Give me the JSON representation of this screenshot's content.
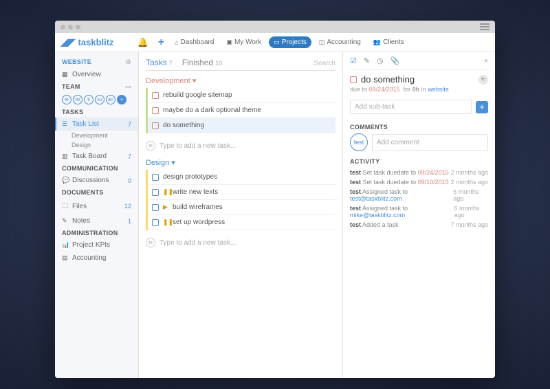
{
  "brand": "taskblitz",
  "topnav": {
    "dashboard": "Dashboard",
    "mywork": "My Work",
    "projects": "Projects",
    "accounting": "Accounting",
    "clients": "Clients"
  },
  "sidebar": {
    "website": "WEBSITE",
    "overview": "Overview",
    "team": "TEAM",
    "team_members": [
      "te",
      "mi",
      "ti",
      "su",
      "an"
    ],
    "tasks": "TASKS",
    "tasklist": "Task List",
    "tasklist_count": "7",
    "dev": "Development",
    "design": "Design",
    "taskboard": "Task Board",
    "taskboard_count": "7",
    "communication": "COMMUNICATION",
    "discussions": "Discussions",
    "discussions_count": "0",
    "documents": "DOCUMENTS",
    "files": "Files",
    "files_count": "12",
    "notes": "Notes",
    "notes_count": "1",
    "administration": "ADMINISTRATION",
    "kpis": "Project KPIs",
    "accounting": "Accounting"
  },
  "tabs": {
    "tasks": "Tasks",
    "tasks_count": "7",
    "finished": "Finished",
    "finished_count": "10",
    "search": "Search"
  },
  "groups": {
    "dev": "Development",
    "design": "Design"
  },
  "tasks_dev": [
    "rebuild google sitemap",
    "maybe do a dark optional theme",
    "do something"
  ],
  "tasks_design": [
    "design prototypes",
    "write new texts",
    "build wireframes",
    "set up wordpress"
  ],
  "new_task_placeholder": "Type to add a new task...",
  "detail": {
    "title": "do something",
    "due_label": "due to",
    "due_date": "09/24/2015",
    "for_label": "for",
    "hours": "0h",
    "in_label": "in",
    "project": "website",
    "subtask_placeholder": "Add sub-task",
    "comments": "COMMENTS",
    "comment_avatar": "test",
    "comment_placeholder": "Add comment",
    "activity": "ACTIVITY",
    "badge": "te"
  },
  "activity": [
    {
      "user": "test",
      "action": "Set task duedate to",
      "date": "09/24/2015",
      "time": "2 months ago"
    },
    {
      "user": "test",
      "action": "Set task duedate to",
      "date": "09/10/2015",
      "time": "2 months ago"
    },
    {
      "user": "test",
      "action": "Assigned task to",
      "email": "test@taskblitz.com",
      "time": "6 months ago"
    },
    {
      "user": "test",
      "action": "Assigned task to",
      "email": "mike@taskblitz.com",
      "time": "6 months ago"
    },
    {
      "user": "test",
      "action": "Added a task",
      "time": "7 months ago"
    }
  ]
}
